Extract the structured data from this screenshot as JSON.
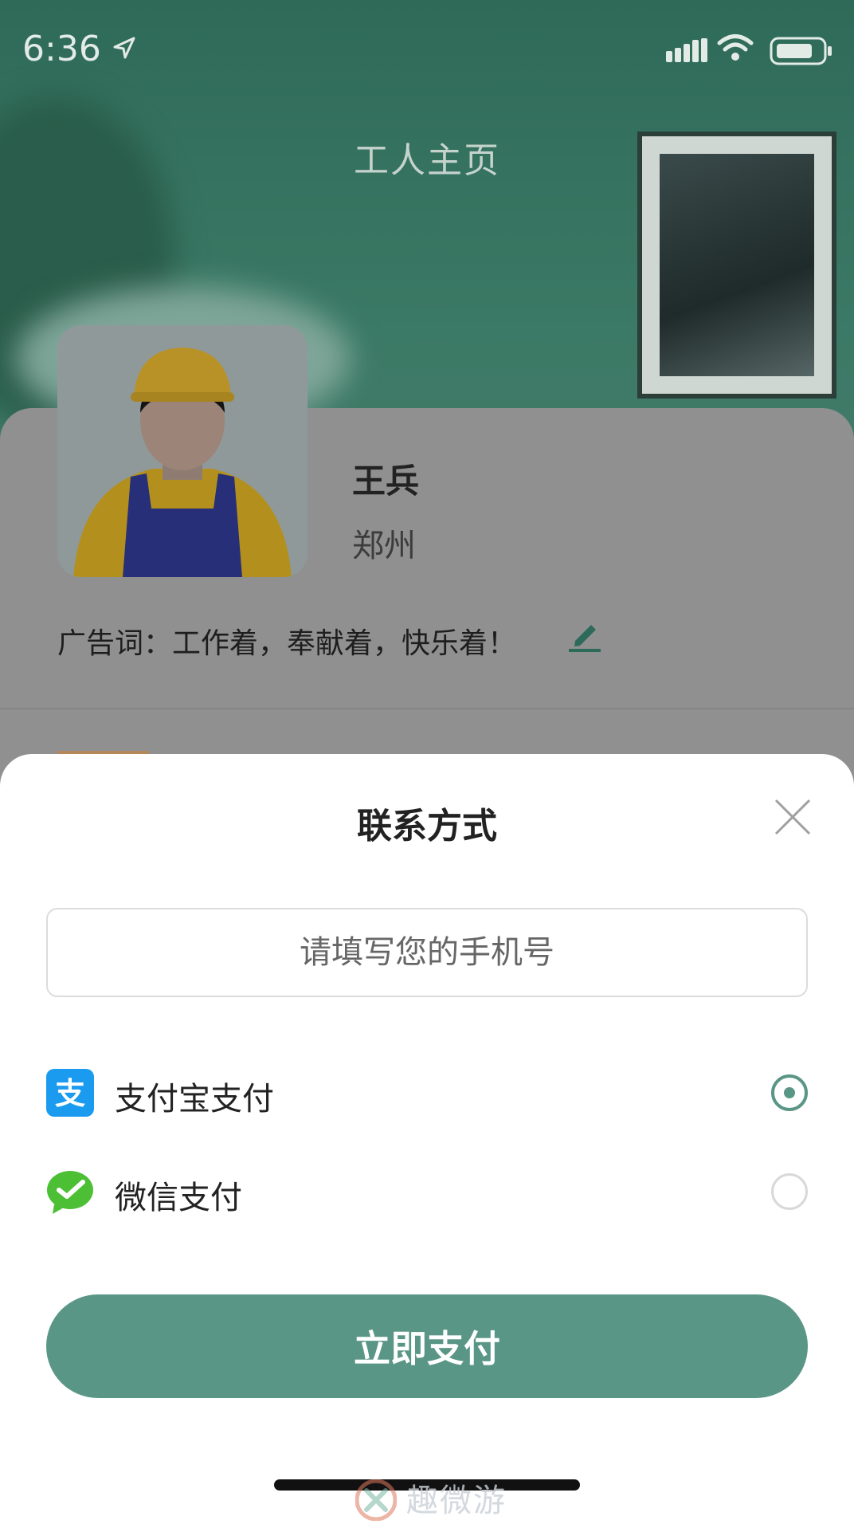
{
  "status_bar": {
    "time": "6:36"
  },
  "header": {
    "title": "工人主页"
  },
  "profile": {
    "name": "王兵",
    "city": "郑州",
    "slogan": "广告词：工作着，奉献着，快乐着！"
  },
  "contact_sheet": {
    "title": "联系方式",
    "phone_placeholder": "请填写您的手机号",
    "phone_value": "",
    "payment_options": [
      {
        "label": "支付宝支付",
        "icon": "alipay-icon",
        "selected": true
      },
      {
        "label": "微信支付",
        "icon": "wechat-pay-icon",
        "selected": false
      }
    ],
    "submit_label": "立即支付"
  },
  "watermark": {
    "text": "趣微游"
  },
  "colors": {
    "accent": "#5a9686",
    "alipay": "#1a9bf0",
    "wechat": "#4cbf34"
  }
}
